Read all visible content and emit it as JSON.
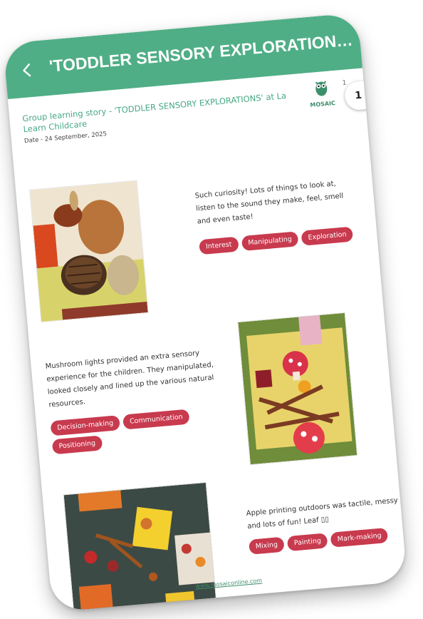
{
  "header": {
    "title": "'TODDLER SENSORY EXPLORATIONS' at..."
  },
  "story": {
    "title": "Group learning story - 'TODDLER SENSORY EXPLORATIONS' at La Learn Childcare",
    "date": "Date - 24 September, 2025",
    "logo_text": "MOSAIC",
    "logo_tail": "1",
    "page_number": "1"
  },
  "sections": [
    {
      "text": "Such curiosity! Lots of things to look at, listen to the sound they make, feel, smell and even taste!",
      "tags": [
        "Interest",
        "Manipulating",
        "Exploration"
      ]
    },
    {
      "text": "Mushroom lights provided an extra sensory experience for the children. They manipulated, looked closely and lined up the various natural resources.",
      "tags": [
        "Decision-making",
        "Communication",
        "Positioning"
      ]
    },
    {
      "text": "Apple printing outdoors was tactile, messy and lots of fun! Leaf ▯▯",
      "tags": [
        "Mixing",
        "Painting",
        "Mark-making"
      ]
    }
  ],
  "footer": {
    "link": "www.mosaiconline.com"
  },
  "colors": {
    "app_bar": "#4fae86",
    "tag": "#c83a4e",
    "accent_text": "#45a883"
  },
  "icons": {
    "back": "back-arrow-icon",
    "logo": "owl-logo-icon"
  }
}
